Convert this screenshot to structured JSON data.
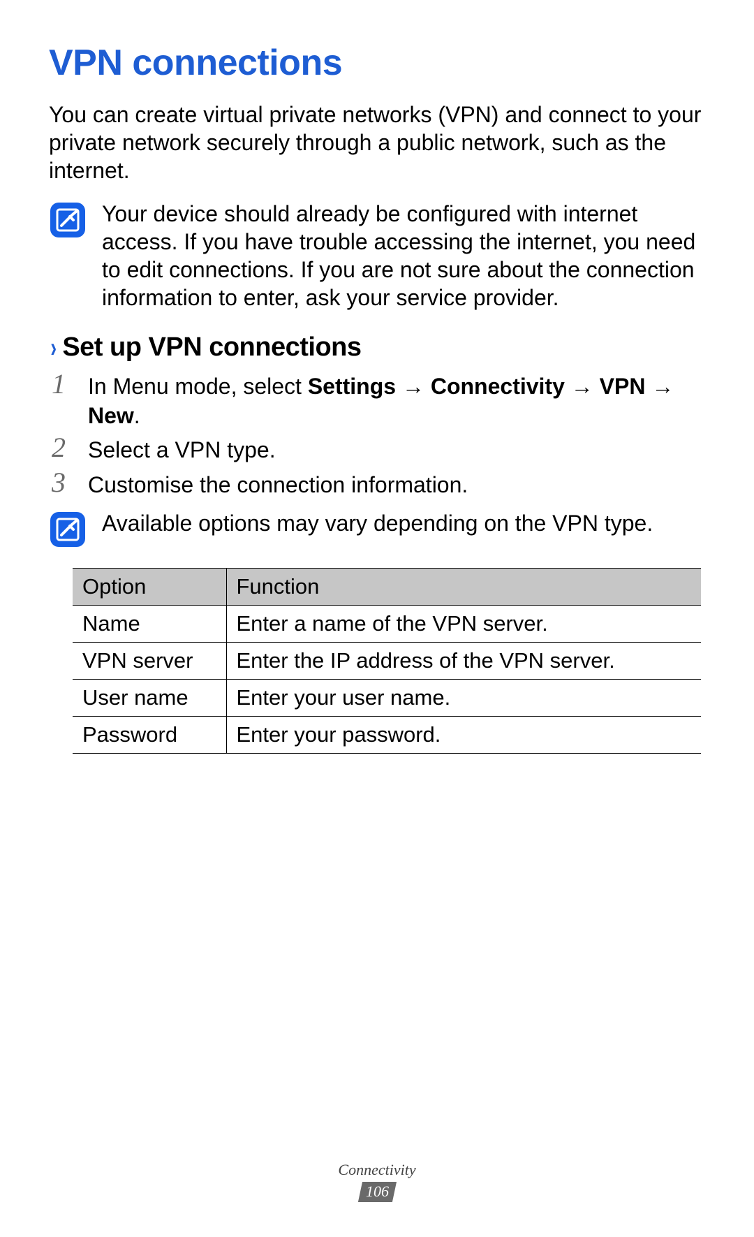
{
  "heading": "VPN connections",
  "intro": "You can create virtual private networks (VPN) and connect to your private network securely through a public network, such as the internet.",
  "note1": "Your device should already be configured with internet access. If you have trouble accessing the internet, you need to edit connections. If you are not sure about the connection information to enter, ask your service provider.",
  "sub": {
    "chevron": "›",
    "title": "Set up VPN connections"
  },
  "steps": {
    "s1_num": "1",
    "s1_pre": "In Menu mode, select ",
    "s1_b1": "Settings",
    "s1_a1": " → ",
    "s1_b2": "Connectivity",
    "s1_a2": " → ",
    "s1_b3": "VPN",
    "s1_a3": " → ",
    "s1_b4": "New",
    "s1_post": ".",
    "s2_num": "2",
    "s2_text": "Select a VPN type.",
    "s3_num": "3",
    "s3_text": "Customise the connection information."
  },
  "note2": "Available options may vary depending on the VPN type.",
  "table": {
    "h1": "Option",
    "h2": "Function",
    "r1c1": "Name",
    "r1c2": "Enter a name of the VPN server.",
    "r2c1": "VPN server",
    "r2c2": "Enter the IP address of the VPN server.",
    "r3c1": "User name",
    "r3c2": "Enter your user name.",
    "r4c1": "Password",
    "r4c2": "Enter your password."
  },
  "footer": {
    "section": "Connectivity",
    "page": "106"
  },
  "icons": {
    "note": "note-icon"
  }
}
